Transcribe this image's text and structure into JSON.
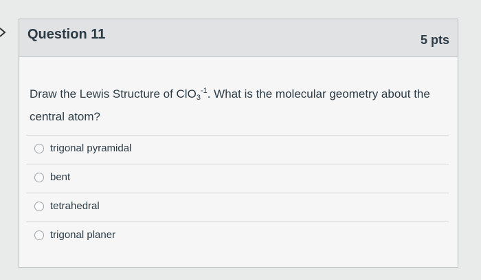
{
  "question": {
    "title": "Question 11",
    "points": "5 pts",
    "text_before": "Draw the Lewis Structure of ClO",
    "subscript": "3",
    "superscript": "-1",
    "text_after": ". What is the molecular geometry about the central atom?"
  },
  "answers": [
    {
      "label": "trigonal pyramidal"
    },
    {
      "label": "bent"
    },
    {
      "label": "tetrahedral"
    },
    {
      "label": "trigonal planer"
    }
  ],
  "icons": {
    "nav": "chevron-right-icon"
  },
  "colors": {
    "text": "#2d3b45",
    "header_bg": "#e1e2e3",
    "card_bg": "#f6f6f6"
  }
}
